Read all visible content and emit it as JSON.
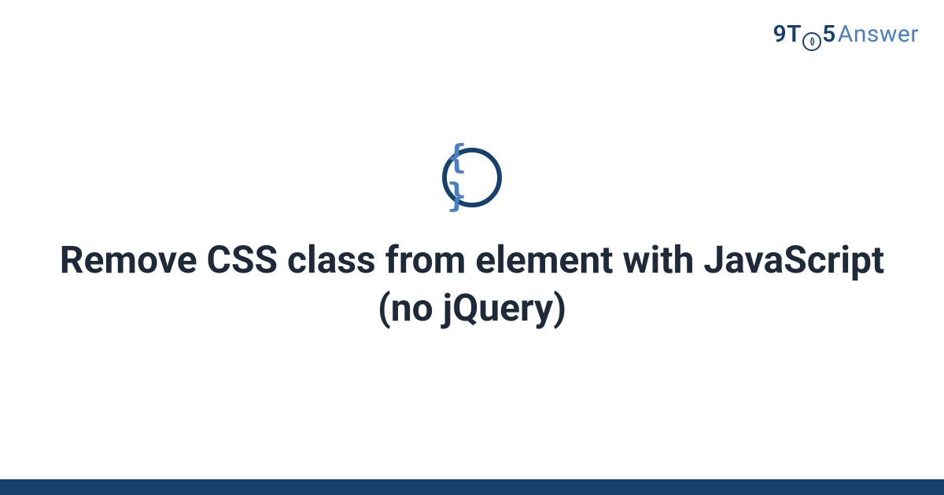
{
  "brand": {
    "prefix": "9T",
    "clock_glyph": "{}",
    "mid": "5",
    "suffix": "Answer"
  },
  "badge": {
    "glyph": "{ }"
  },
  "title": "Remove CSS class from element with JavaScript (no jQuery)",
  "colors": {
    "dark_navy": "#17406d",
    "mid_blue": "#4b7fbf",
    "text": "#1e2a3a"
  }
}
